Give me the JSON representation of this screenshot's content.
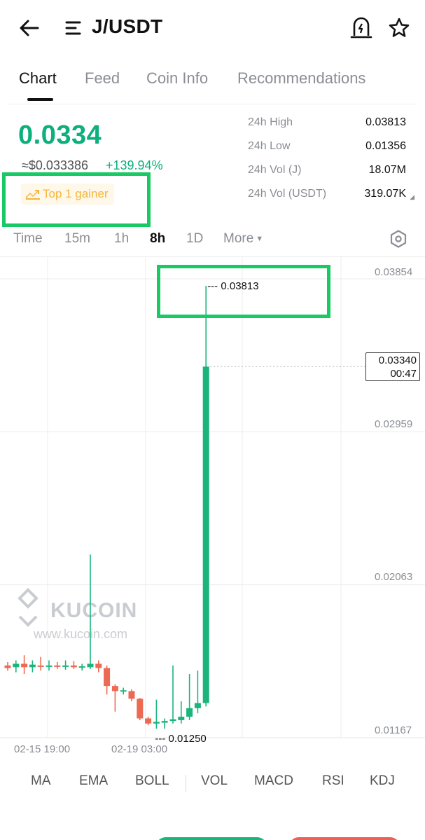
{
  "header": {
    "pair": "J/USDT",
    "icons": {
      "back": "arrow-left-icon",
      "menu": "menu-icon",
      "alert": "price-alert-icon",
      "favorite": "star-icon"
    }
  },
  "tabs": [
    {
      "label": "Chart",
      "active": true
    },
    {
      "label": "Feed",
      "active": false
    },
    {
      "label": "Coin Info",
      "active": false
    },
    {
      "label": "Recommendations",
      "active": false
    }
  ],
  "ticker": {
    "price": "0.0334",
    "usd_price": "≈$0.033386",
    "change": "+139.94%",
    "badge": "Top 1 gainer",
    "price_color": "#0bb07b"
  },
  "stats": [
    {
      "label": "24h High",
      "value": "0.03813"
    },
    {
      "label": "24h Low",
      "value": "0.01356"
    },
    {
      "label": "24h Vol (J)",
      "value": "18.07M"
    },
    {
      "label": "24h Vol (USDT)",
      "value": "319.07K"
    }
  ],
  "intervals": [
    {
      "label": "Time",
      "active": false
    },
    {
      "label": "15m",
      "active": false
    },
    {
      "label": "1h",
      "active": false
    },
    {
      "label": "8h",
      "active": true
    },
    {
      "label": "1D",
      "active": false
    },
    {
      "label": "More",
      "active": false
    }
  ],
  "chart": {
    "y_labels": [
      "0.03854",
      "0.02959",
      "0.02063",
      "0.01167"
    ],
    "x_labels": [
      "02-15 19:00",
      "02-19 03:00"
    ],
    "current_price": "0.03340",
    "countdown": "00:47",
    "high_marker": "0.03813",
    "low_marker": "0.01250",
    "watermark_brand": "KUCOIN",
    "watermark_url": "www.kucoin.com",
    "up_color": "#1bb57c",
    "down_color": "#ec6a53"
  },
  "chart_data": {
    "type": "candlestick",
    "pair": "J/USDT",
    "interval": "8h",
    "ylim": [
      0.01167,
      0.03854
    ],
    "candles": [
      {
        "open": 0.0159,
        "high": 0.0161,
        "low": 0.0156,
        "close": 0.01575
      },
      {
        "open": 0.0158,
        "high": 0.0162,
        "low": 0.0155,
        "close": 0.016
      },
      {
        "open": 0.016,
        "high": 0.0165,
        "low": 0.0154,
        "close": 0.0158
      },
      {
        "open": 0.0158,
        "high": 0.0162,
        "low": 0.0155,
        "close": 0.01595
      },
      {
        "open": 0.0159,
        "high": 0.0164,
        "low": 0.0156,
        "close": 0.01585
      },
      {
        "open": 0.01585,
        "high": 0.0162,
        "low": 0.0156,
        "close": 0.0159
      },
      {
        "open": 0.0159,
        "high": 0.0161,
        "low": 0.0157,
        "close": 0.01585
      },
      {
        "open": 0.01585,
        "high": 0.0162,
        "low": 0.01565,
        "close": 0.0159
      },
      {
        "open": 0.0159,
        "high": 0.01615,
        "low": 0.0157,
        "close": 0.0158
      },
      {
        "open": 0.0158,
        "high": 0.016,
        "low": 0.0156,
        "close": 0.01585
      },
      {
        "open": 0.0158,
        "high": 0.0224,
        "low": 0.0157,
        "close": 0.016
      },
      {
        "open": 0.016,
        "high": 0.0162,
        "low": 0.0155,
        "close": 0.01575
      },
      {
        "open": 0.01575,
        "high": 0.0159,
        "low": 0.0142,
        "close": 0.0147
      },
      {
        "open": 0.0147,
        "high": 0.0148,
        "low": 0.0132,
        "close": 0.0144
      },
      {
        "open": 0.0144,
        "high": 0.0146,
        "low": 0.0142,
        "close": 0.01445
      },
      {
        "open": 0.0144,
        "high": 0.0145,
        "low": 0.0138,
        "close": 0.01395
      },
      {
        "open": 0.01395,
        "high": 0.014,
        "low": 0.0127,
        "close": 0.0128
      },
      {
        "open": 0.0128,
        "high": 0.0129,
        "low": 0.0124,
        "close": 0.0125
      },
      {
        "open": 0.0125,
        "high": 0.0139,
        "low": 0.0122,
        "close": 0.0126
      },
      {
        "open": 0.01255,
        "high": 0.0128,
        "low": 0.0122,
        "close": 0.01265
      },
      {
        "open": 0.01265,
        "high": 0.0159,
        "low": 0.0125,
        "close": 0.01275
      },
      {
        "open": 0.0127,
        "high": 0.0138,
        "low": 0.0125,
        "close": 0.0129
      },
      {
        "open": 0.0129,
        "high": 0.0154,
        "low": 0.0127,
        "close": 0.0134
      },
      {
        "open": 0.0134,
        "high": 0.0156,
        "low": 0.0131,
        "close": 0.0137
      },
      {
        "open": 0.0137,
        "high": 0.03813,
        "low": 0.0135,
        "close": 0.0334
      }
    ]
  },
  "indicators": [
    "MA",
    "EMA",
    "BOLL",
    "VOL",
    "MACD",
    "RSI",
    "KDJ"
  ]
}
